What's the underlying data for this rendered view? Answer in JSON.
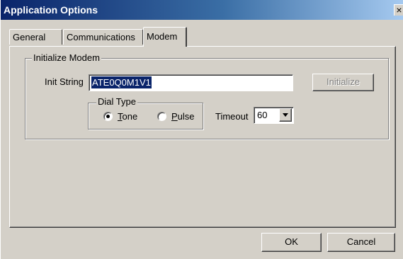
{
  "window": {
    "title": "Application Options",
    "close_glyph": "×",
    "titlebar_color": "#0a246a",
    "face_color": "#d4d0c8"
  },
  "tabs": [
    {
      "label": "General",
      "selected": false
    },
    {
      "label": "Communications",
      "selected": false
    },
    {
      "label": "Modem",
      "selected": true
    }
  ],
  "initialize_modem": {
    "group_label": "Initialize Modem",
    "init_string_label": "Init String",
    "init_string_value": "ATE0Q0M1V1",
    "initialize_button": "Initialize",
    "initialize_enabled": false,
    "dial_type": {
      "group_label": "Dial Type",
      "tone": {
        "label": "Tone",
        "mnemonic": "T",
        "rest": "one",
        "checked": true
      },
      "pulse": {
        "label": "Pulse",
        "mnemonic": "P",
        "rest": "ulse",
        "checked": false
      }
    },
    "timeout_label": "Timeout",
    "timeout_value": "60",
    "dropdown_icon": "triangle-down"
  },
  "footer": {
    "ok_label": "OK",
    "cancel_label": "Cancel"
  }
}
